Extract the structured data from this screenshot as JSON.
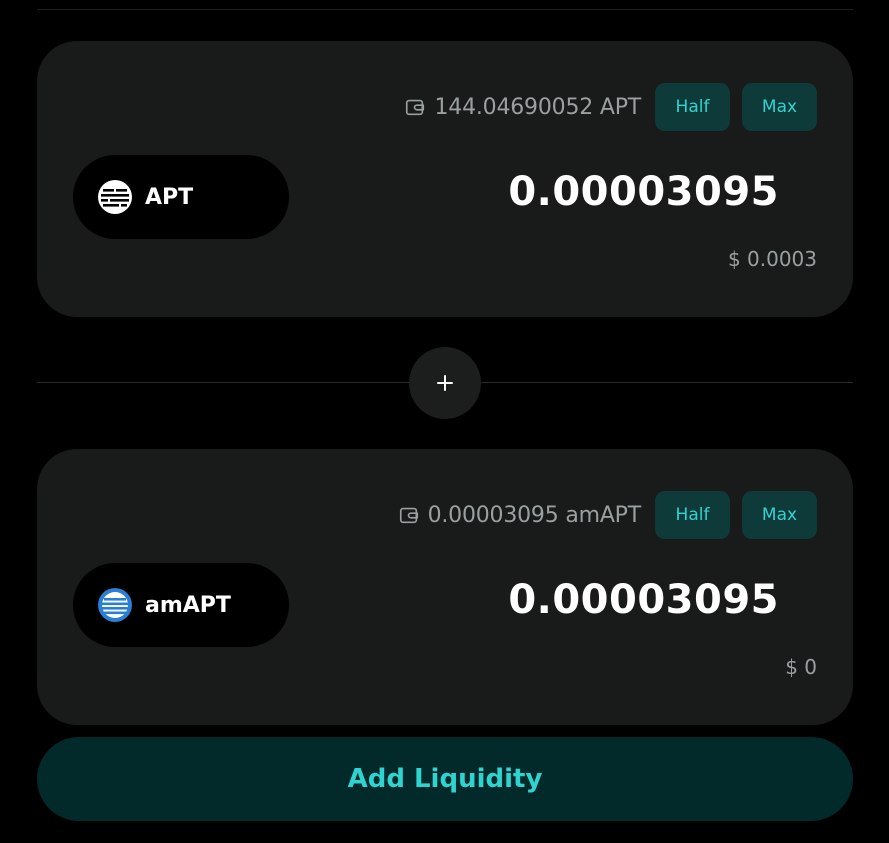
{
  "top": {
    "balance_amount": "144.04690052 APT",
    "half_label": "Half",
    "max_label": "Max",
    "token_symbol": "APT",
    "token_icon": "aptos-logo-icon",
    "amount_value": "0.00003095",
    "usd_value": "$ 0.0003"
  },
  "add_button": {
    "icon": "plus-icon"
  },
  "bottom": {
    "balance_amount": "0.00003095 amAPT",
    "half_label": "Half",
    "max_label": "Max",
    "token_symbol": "amAPT",
    "token_icon": "amapt-logo-icon",
    "amount_value": "0.00003095",
    "usd_value": "$ 0"
  },
  "submit": {
    "label": "Add Liquidity"
  },
  "colors": {
    "background": "#000000",
    "card": "#191a1a",
    "accent": "#2fd4d0",
    "accent_bg": "#0f3a3a",
    "submit_bg": "#032a2a",
    "muted_text": "#9aa0a0"
  }
}
